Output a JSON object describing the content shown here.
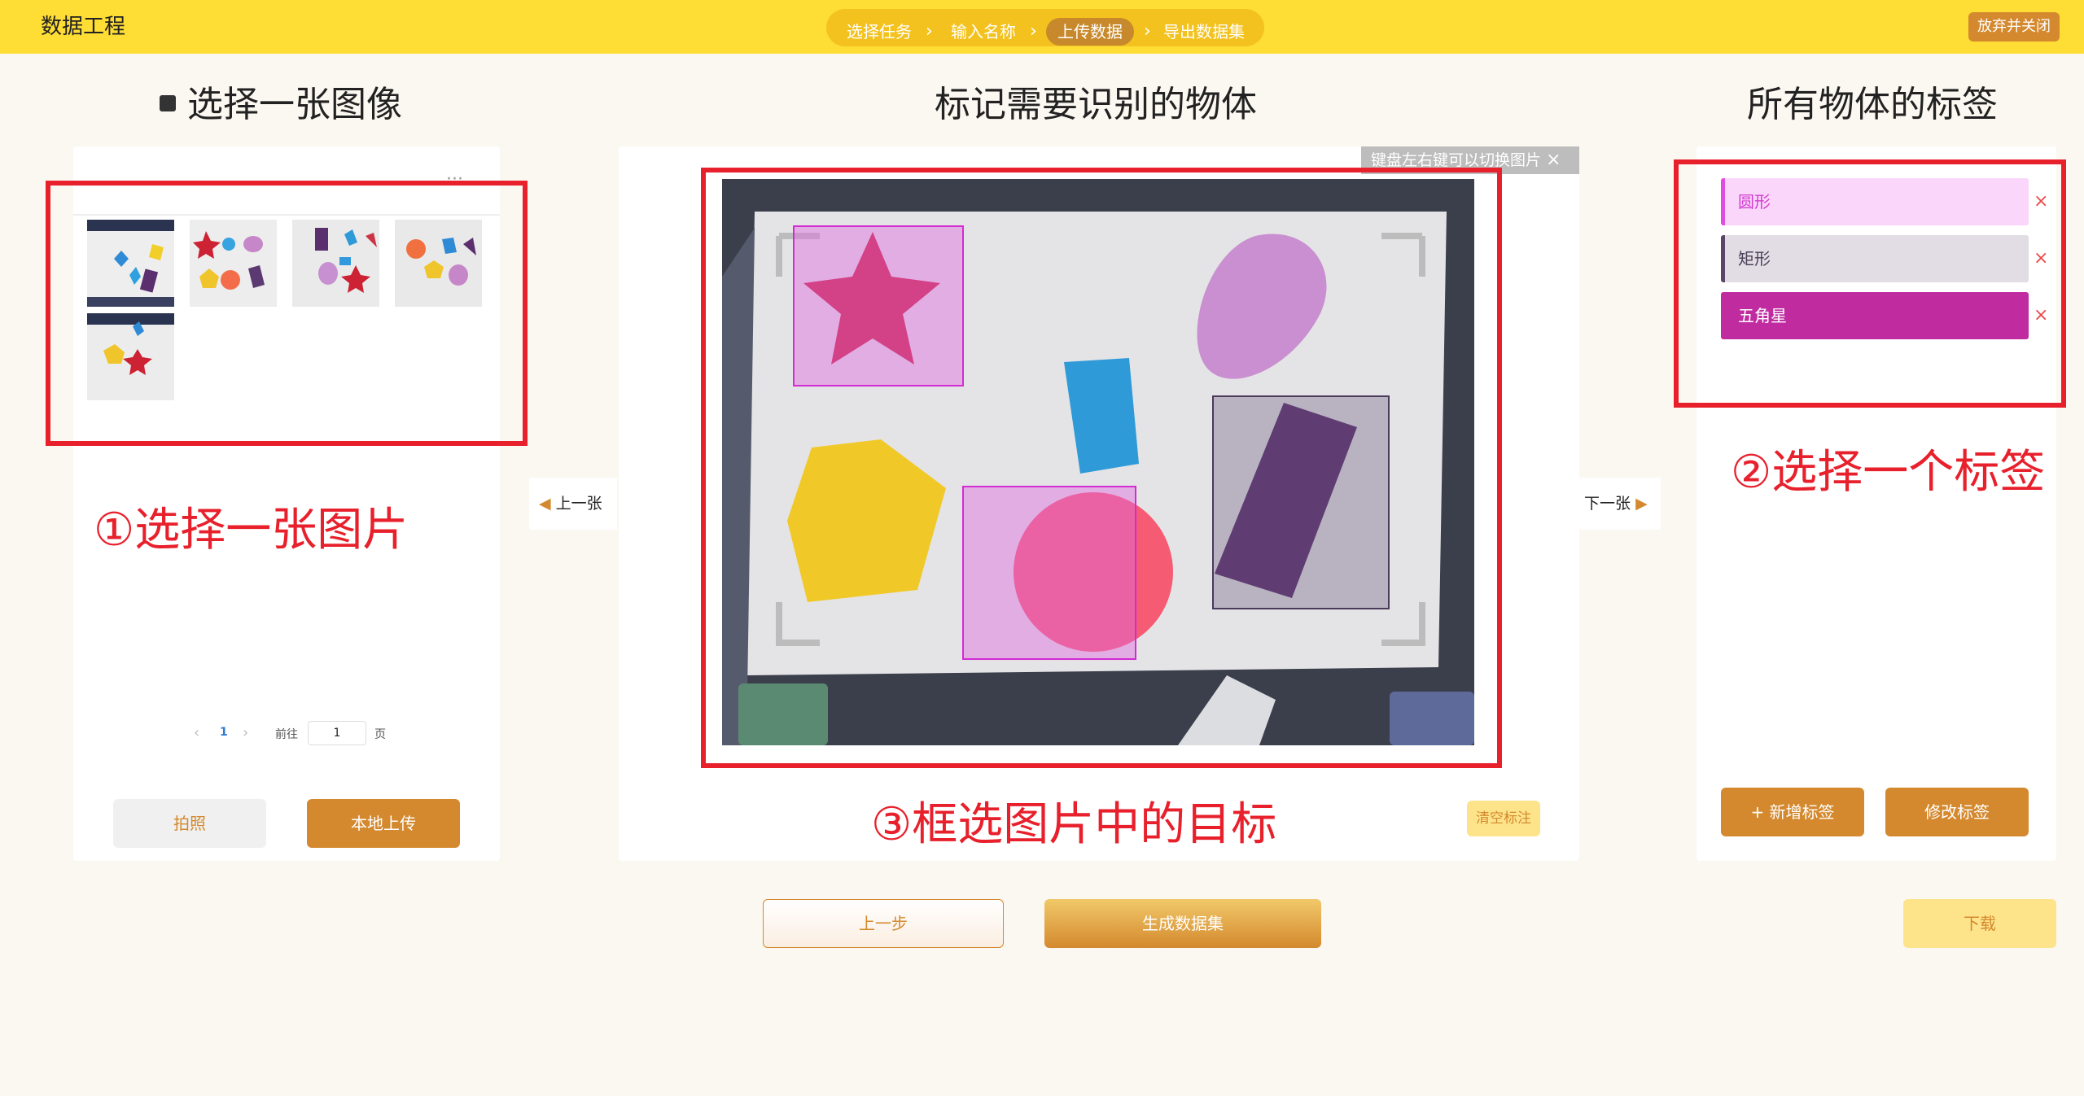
{
  "header": {
    "app_title": "数据工程",
    "steps": [
      "选择任务",
      "输入名称",
      "上传数据",
      "导出数据集"
    ],
    "active_step": "上传数据",
    "close_label": "放弃并关闭"
  },
  "left": {
    "title": "选择一张图像",
    "more": "···",
    "pagination": {
      "prev": "‹",
      "current": "1",
      "next": "›",
      "goto_label": "前往",
      "goto_value": "1",
      "page_unit": "页"
    },
    "photo_label": "拍照",
    "upload_label": "本地上传",
    "annotation": "①选择一张图片"
  },
  "center": {
    "title": "标记需要识别的物体",
    "hint": "键盘左右键可以切换图片",
    "hint_close": "×",
    "prev_label": "上一张",
    "next_label": "下一张",
    "clear_label": "清空标注",
    "annotation": "③框选图片中的目标"
  },
  "right": {
    "title": "所有物体的标签",
    "tags": [
      {
        "label": "圆形",
        "bg": "#fbd6fb",
        "bar": "#e04ce0",
        "text": "#d13bd1"
      },
      {
        "label": "矩形",
        "bg": "#e2dde4",
        "bar": "#5b4666",
        "text": "#4b3f57"
      },
      {
        "label": "五角星",
        "bg": "#c02ca0",
        "bar": "#c02ca0",
        "text": "#ffffff"
      }
    ],
    "remove": "×",
    "add_label": "+ 新增标签",
    "edit_label": "修改标签",
    "annotation": "②选择一个标签"
  },
  "footer": {
    "back_label": "上一步",
    "generate_label": "生成数据集",
    "download_label": "下载"
  },
  "colors": {
    "accent": "#d4892e",
    "topbar": "#fedd34",
    "annotation_red": "#e8202c"
  }
}
